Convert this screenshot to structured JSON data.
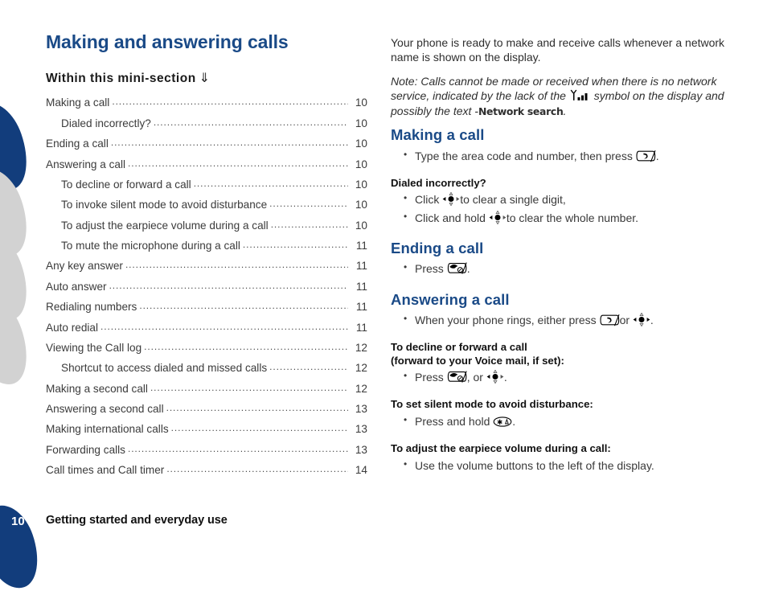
{
  "document": {
    "title": "Making and answering calls",
    "toc_heading": "Within this mini-section",
    "toc_arrow": "⇓"
  },
  "toc": {
    "items": [
      {
        "label": "Making a call",
        "page": "10",
        "level": 1
      },
      {
        "label": "Dialed incorrectly?",
        "page": "10",
        "level": 2
      },
      {
        "label": "Ending a call",
        "page": "10",
        "level": 1
      },
      {
        "label": "Answering a call",
        "page": "10",
        "level": 1
      },
      {
        "label": "To decline or forward a call",
        "page": "10",
        "level": 2
      },
      {
        "label": "To invoke silent mode to avoid disturbance",
        "page": "10",
        "level": 2
      },
      {
        "label": "To adjust the earpiece volume during a call",
        "page": "10",
        "level": 2
      },
      {
        "label": "To mute the microphone during a call",
        "page": "11",
        "level": 2
      },
      {
        "label": "Any key answer",
        "page": "11",
        "level": 1
      },
      {
        "label": "Auto answer",
        "page": "11",
        "level": 1
      },
      {
        "label": "Redialing numbers",
        "page": "11",
        "level": 1
      },
      {
        "label": "Auto redial",
        "page": "11",
        "level": 1
      },
      {
        "label": "Viewing the Call log",
        "page": "12",
        "level": 1
      },
      {
        "label": "Shortcut to access dialed and missed calls",
        "page": "12",
        "level": 2
      },
      {
        "label": "Making a second call",
        "page": "12",
        "level": 1
      },
      {
        "label": "Answering a second call",
        "page": "13",
        "level": 1
      },
      {
        "label": "Making international calls",
        "page": "13",
        "level": 1
      },
      {
        "label": "Forwarding calls",
        "page": "13",
        "level": 1
      },
      {
        "label": "Call times and Call timer",
        "page": "14",
        "level": 1
      }
    ]
  },
  "content": {
    "intro": "Your phone is ready to make and receive calls whenever a network name is shown on the display.",
    "note_part1": "Note: Calls cannot be made or received when there is no network service, indicated by the lack of the",
    "note_part2": "symbol on the display and possibly the text -",
    "note_network_search": "Network search",
    "note_period": ".",
    "sections": [
      {
        "heading": "Making a call",
        "bullets": [
          {
            "before": "Type the area code and number, then press",
            "icon": "call-key-icon",
            "after": "."
          }
        ],
        "sub": [
          {
            "heading": "Dialed incorrectly?",
            "bullets": [
              {
                "before": "Click",
                "icon": "navigation-key-icon",
                "after": "to clear a single digit,"
              },
              {
                "before": "Click and hold",
                "icon": "navigation-key-icon",
                "after": "to clear the whole number."
              }
            ]
          }
        ]
      },
      {
        "heading": "Ending a call",
        "bullets": [
          {
            "before": "Press",
            "icon": "end-call-key-icon",
            "after": "."
          }
        ],
        "sub": []
      },
      {
        "heading": "Answering a call",
        "bullets": [
          {
            "before": "When your phone rings, either press",
            "icon": "call-key-icon",
            "middle": "or",
            "icon2": "navigation-key-icon",
            "after": "."
          }
        ],
        "sub": [
          {
            "heading": "To decline or forward a call",
            "heading_line2": "(forward to your Voice mail, if set):",
            "bullets": [
              {
                "before": "Press",
                "icon": "end-call-key-icon",
                "middle": ", or",
                "icon2": "navigation-key-icon",
                "after": "."
              }
            ]
          },
          {
            "heading": "To set silent mode to avoid disturbance:",
            "bullets": [
              {
                "before": "Press and hold",
                "icon": "star-key-icon",
                "after": "."
              }
            ]
          },
          {
            "heading": "To adjust the earpiece volume during a call:",
            "bullets": [
              {
                "before": "Use the volume buttons to the left of the display.",
                "icon": "",
                "after": ""
              }
            ]
          }
        ]
      }
    ]
  },
  "footer": {
    "page_number": "10",
    "section_label": "Getting started and everyday use"
  },
  "colors": {
    "heading_blue": "#1a4a87",
    "decor_blue": "#123d7c",
    "decor_gray": "#d2d2d2",
    "body_text": "#3a3a3a"
  }
}
